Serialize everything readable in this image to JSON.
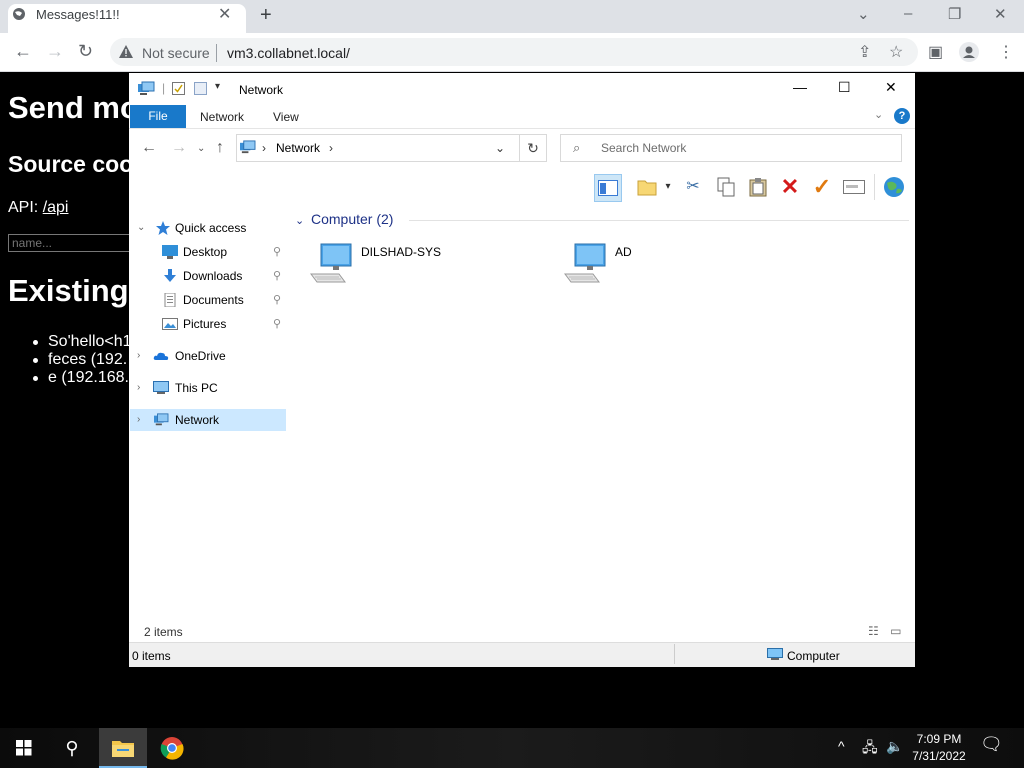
{
  "browser": {
    "tab_title": "Messages!11!!",
    "tab_close": "✕",
    "new_tab": "+",
    "security_label": "Not secure",
    "url": "vm3.collabnet.local/",
    "window_controls": [
      "⌄",
      "–",
      "❐",
      "✕"
    ]
  },
  "page": {
    "heading_send": "Send mo",
    "heading_source": "Source coo",
    "api_label": "API:",
    "api_link": "/api",
    "name_placeholder": "name...",
    "heading_existing": "Existing",
    "messages": [
      "So'hello<h1",
      "feces (192.",
      "e (192.168."
    ]
  },
  "explorer": {
    "title": "Network",
    "ribbon_tabs": {
      "file": "File",
      "network": "Network",
      "view": "View"
    },
    "help": "?",
    "address_path": "Network",
    "search_placeholder": "Search Network",
    "nav": {
      "quick_access": "Quick access",
      "desktop": "Desktop",
      "downloads": "Downloads",
      "documents": "Documents",
      "pictures": "Pictures",
      "onedrive": "OneDrive",
      "this_pc": "This PC",
      "network": "Network"
    },
    "group_header": "Computer (2)",
    "computers": [
      "DILSHAD-SYS",
      "AD"
    ],
    "items_count": "2 items",
    "status_selected": "0 items",
    "status_type": "Computer"
  },
  "taskbar": {
    "time": "7:09 PM",
    "date": "7/31/2022"
  },
  "colors": {
    "accent": "#1979ca",
    "nav_selected": "#cce8ff",
    "group_header": "#1e3287"
  }
}
